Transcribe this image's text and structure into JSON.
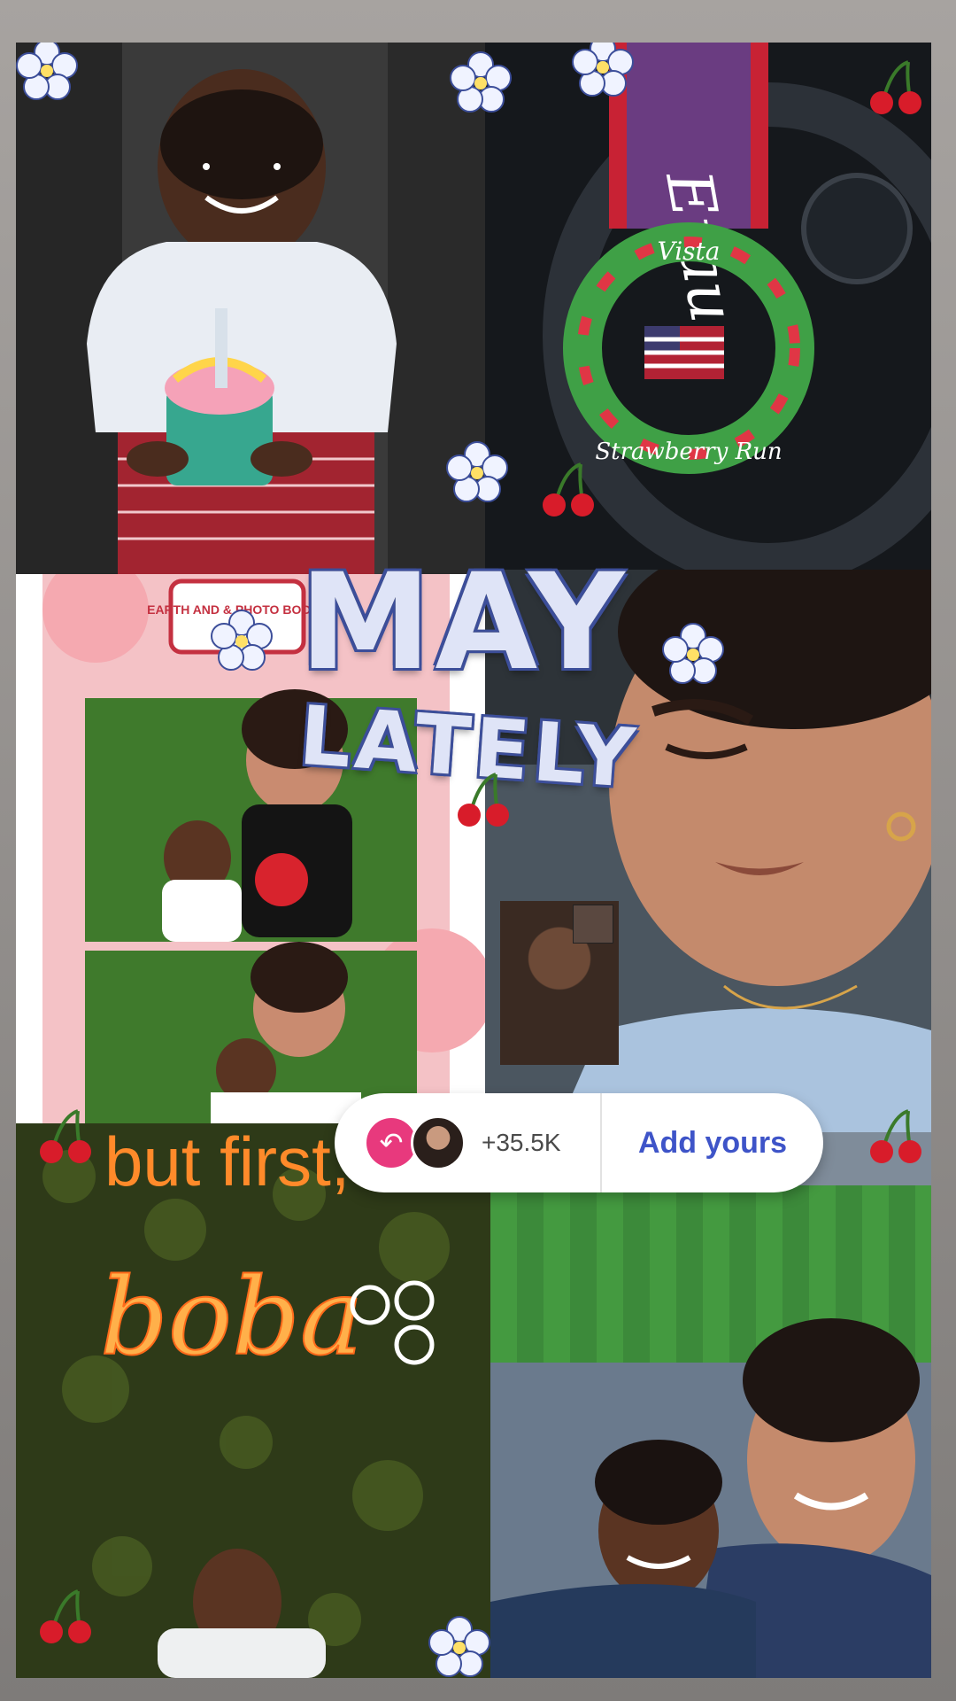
{
  "collage": {
    "title_line1": "MAY",
    "title_line2": "LATELY",
    "neon_line1": "but first,",
    "neon_line2": "boba",
    "medal_top": "Vista",
    "medal_bottom": "Strawberry Run",
    "booth_sign": "EARTH AND & PHOTO BOOTH"
  },
  "add_yours_sticker": {
    "reply_icon": "reply-arrow-icon",
    "count": "+35.5K",
    "button_label": "Add yours",
    "accent_color": "#e8397d",
    "button_color": "#3e54c8"
  },
  "colors": {
    "title_fill": "#dfe4f7",
    "title_outline": "#3c4e9a",
    "neon_orange": "#ff8a2a",
    "cherry_red": "#d81c2a"
  }
}
